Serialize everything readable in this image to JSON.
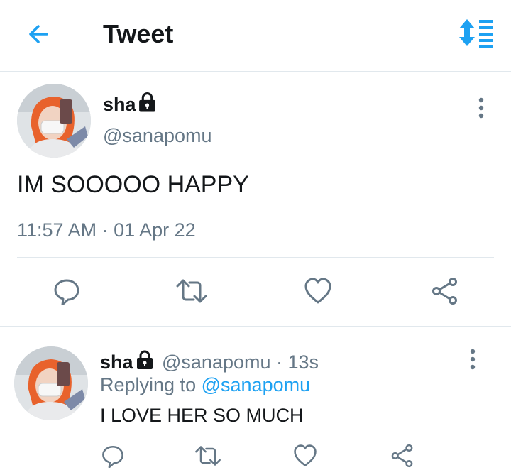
{
  "header": {
    "title": "Tweet",
    "back_icon": "arrow-left-icon",
    "sort_icon": "sort-icon",
    "accent": "#1da1f2"
  },
  "main_tweet": {
    "display_name": "sha",
    "handle": "@sanapomu",
    "text": "IM SOOOOO HAPPY",
    "timestamp": "11:57 AM · 01 Apr 22",
    "locked_icon": "lock-icon",
    "actions": [
      "reply-icon",
      "retweet-icon",
      "like-icon",
      "share-icon"
    ]
  },
  "reply_tweet": {
    "display_name": "sha",
    "handle": "@sanapomu",
    "time": "· 13s",
    "replying_prefix": "Replying to",
    "replying_handle": "@sanapomu",
    "text": "I LOVE HER SO MUCH",
    "locked_icon": "lock-icon",
    "actions": [
      "reply-icon",
      "retweet-icon",
      "like-icon",
      "share-icon"
    ]
  },
  "colors": {
    "text": "#14171a",
    "secondary": "#657786",
    "link": "#1da1f2",
    "divider": "#e1e8ed"
  }
}
